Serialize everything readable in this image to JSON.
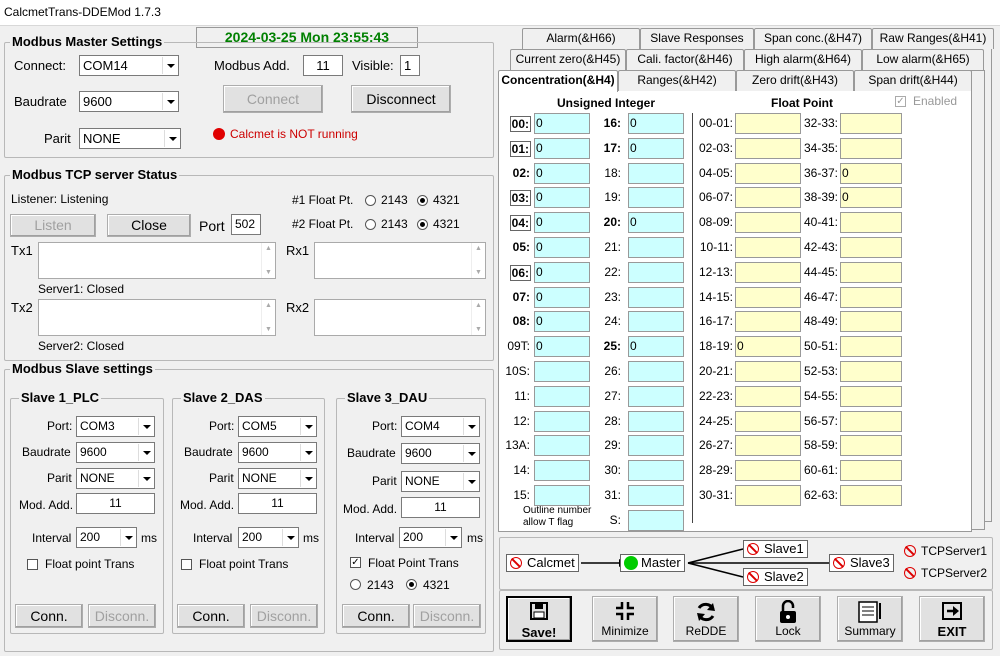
{
  "window": {
    "title": "CalcmetTrans-DDEMod   1.7.3"
  },
  "clock": "2024-03-25 Mon 23:55:43",
  "master": {
    "title": "Modbus Master Settings",
    "connect_label": "Connect:",
    "port": "COM14",
    "baud_label": "Baudrate",
    "baud": "9600",
    "parit_label": "Parit",
    "parit": "NONE",
    "modadd_label": "Modbus Add.",
    "modadd": "11",
    "visible_label": "Visible:",
    "visible": "1",
    "connect_btn": "Connect",
    "disconnect_btn": "Disconnect",
    "status": "Calcmet is NOT running"
  },
  "tcp": {
    "title": "Modbus TCP server Status",
    "listener": "Listener:  Listening",
    "listen_btn": "Listen",
    "close_btn": "Close",
    "port_label": "Port",
    "port": "502",
    "fp1_label": "#1 Float Pt.",
    "fp2_label": "#2 Float Pt.",
    "opt_a": "2143",
    "opt_b": "4321",
    "tx1": "Tx1",
    "rx1": "Rx1",
    "tx2": "Tx2",
    "rx2": "Rx2",
    "server1": "Server1:  Closed",
    "server2": "Server2:  Closed"
  },
  "slaves_title": "Modbus Slave settings",
  "slaves": [
    {
      "title": "Slave 1_PLC",
      "port": "COM3",
      "baud": "9600",
      "parit": "NONE",
      "modadd": "11",
      "interval": "200",
      "float_trans": "Float point Trans"
    },
    {
      "title": "Slave 2_DAS",
      "port": "COM5",
      "baud": "9600",
      "parit": "NONE",
      "modadd": "11",
      "interval": "200",
      "float_trans": "Float point Trans"
    },
    {
      "title": "Slave 3_DAU",
      "port": "COM4",
      "baud": "9600",
      "parit": "NONE",
      "modadd": "11",
      "interval": "200",
      "float_trans": "Float Point Trans",
      "opt_a": "2143",
      "opt_b": "4321"
    }
  ],
  "slave_labels": {
    "port": "Port:",
    "baud": "Baudrate",
    "parit": "Parit",
    "modadd": "Mod. Add.",
    "interval": "Interval",
    "ms": "ms",
    "conn": "Conn.",
    "disconn": "Disconn."
  },
  "tabs": {
    "row1": [
      "Alarm(&H66)",
      "Slave Responses",
      "Span conc.(&H47)",
      "Raw Ranges(&H41)"
    ],
    "row2": [
      "Current zero(&H45)",
      "Cali. factor(&H46)",
      "High alarm(&H64)",
      "Low alarm(&H65)"
    ],
    "row3": [
      "Concentration(&H4)",
      "Ranges(&H42)",
      "Zero drift(&H43)",
      "Span drift(&H44)"
    ]
  },
  "conc": {
    "unsigned_title": "Unsigned Integer",
    "float_title": "Float Point",
    "enabled": "Enabled",
    "col1": [
      {
        "l": "00:",
        "v": "0"
      },
      {
        "l": "01:",
        "v": "0"
      },
      {
        "l": "02:",
        "v": "0"
      },
      {
        "l": "03:",
        "v": "0"
      },
      {
        "l": "04:",
        "v": "0"
      },
      {
        "l": "05:",
        "v": "0"
      },
      {
        "l": "06:",
        "v": "0"
      },
      {
        "l": "07:",
        "v": "0"
      },
      {
        "l": "08:",
        "v": "0"
      },
      {
        "l": "09T:",
        "v": "0"
      },
      {
        "l": "10S:",
        "v": ""
      },
      {
        "l": "11:",
        "v": ""
      },
      {
        "l": "12:",
        "v": ""
      },
      {
        "l": "13A:",
        "v": ""
      },
      {
        "l": "14:",
        "v": ""
      },
      {
        "l": "15:",
        "v": ""
      }
    ],
    "col2": [
      {
        "l": "16:",
        "v": "0"
      },
      {
        "l": "17:",
        "v": "0"
      },
      {
        "l": "18:",
        "v": ""
      },
      {
        "l": "19:",
        "v": ""
      },
      {
        "l": "20:",
        "v": "0"
      },
      {
        "l": "21:",
        "v": ""
      },
      {
        "l": "22:",
        "v": ""
      },
      {
        "l": "23:",
        "v": ""
      },
      {
        "l": "24:",
        "v": ""
      },
      {
        "l": "25:",
        "v": "0"
      },
      {
        "l": "26:",
        "v": ""
      },
      {
        "l": "27:",
        "v": ""
      },
      {
        "l": "28:",
        "v": ""
      },
      {
        "l": "29:",
        "v": ""
      },
      {
        "l": "30:",
        "v": ""
      },
      {
        "l": "31:",
        "v": ""
      },
      {
        "l": "S:",
        "v": ""
      }
    ],
    "col3": [
      {
        "l": "00-01:",
        "v": ""
      },
      {
        "l": "02-03:",
        "v": ""
      },
      {
        "l": "04-05:",
        "v": ""
      },
      {
        "l": "06-07:",
        "v": ""
      },
      {
        "l": "08-09:",
        "v": ""
      },
      {
        "l": "10-11:",
        "v": ""
      },
      {
        "l": "12-13:",
        "v": ""
      },
      {
        "l": "14-15:",
        "v": ""
      },
      {
        "l": "16-17:",
        "v": ""
      },
      {
        "l": "18-19:",
        "v": "0"
      },
      {
        "l": "20-21:",
        "v": ""
      },
      {
        "l": "22-23:",
        "v": ""
      },
      {
        "l": "24-25:",
        "v": ""
      },
      {
        "l": "26-27:",
        "v": ""
      },
      {
        "l": "28-29:",
        "v": ""
      },
      {
        "l": "30-31:",
        "v": ""
      }
    ],
    "col4": [
      {
        "l": "32-33:",
        "v": ""
      },
      {
        "l": "34-35:",
        "v": ""
      },
      {
        "l": "36-37:",
        "v": "0"
      },
      {
        "l": "38-39:",
        "v": "0"
      },
      {
        "l": "40-41:",
        "v": ""
      },
      {
        "l": "42-43:",
        "v": ""
      },
      {
        "l": "44-45:",
        "v": ""
      },
      {
        "l": "46-47:",
        "v": ""
      },
      {
        "l": "48-49:",
        "v": ""
      },
      {
        "l": "50-51:",
        "v": ""
      },
      {
        "l": "52-53:",
        "v": ""
      },
      {
        "l": "54-55:",
        "v": ""
      },
      {
        "l": "56-57:",
        "v": ""
      },
      {
        "l": "58-59:",
        "v": ""
      },
      {
        "l": "60-61:",
        "v": ""
      },
      {
        "l": "62-63:",
        "v": ""
      }
    ],
    "note1": "Outline number",
    "note2": "allow T flag"
  },
  "flow": {
    "calcmet": "Calcmet",
    "master": "Master",
    "slave1": "Slave1",
    "slave2": "Slave2",
    "slave3": "Slave3",
    "tcp1": "TCPServer1",
    "tcp2": "TCPServer2"
  },
  "buttons": [
    {
      "label": "Save!",
      "icon": "save-icon"
    },
    {
      "label": "Minimize",
      "icon": "minimize-icon"
    },
    {
      "label": "ReDDE",
      "icon": "refresh-icon"
    },
    {
      "label": "Lock",
      "icon": "lock-icon"
    },
    {
      "label": "Summary",
      "icon": "summary-icon"
    },
    {
      "label": "EXIT",
      "icon": "exit-icon"
    }
  ],
  "colors": {
    "clock": "#008000",
    "status_red": "#cc0000",
    "cyan_cell": "#ccffff",
    "yellow_cell": "#ffffcc",
    "master_green": "#00cc00"
  }
}
